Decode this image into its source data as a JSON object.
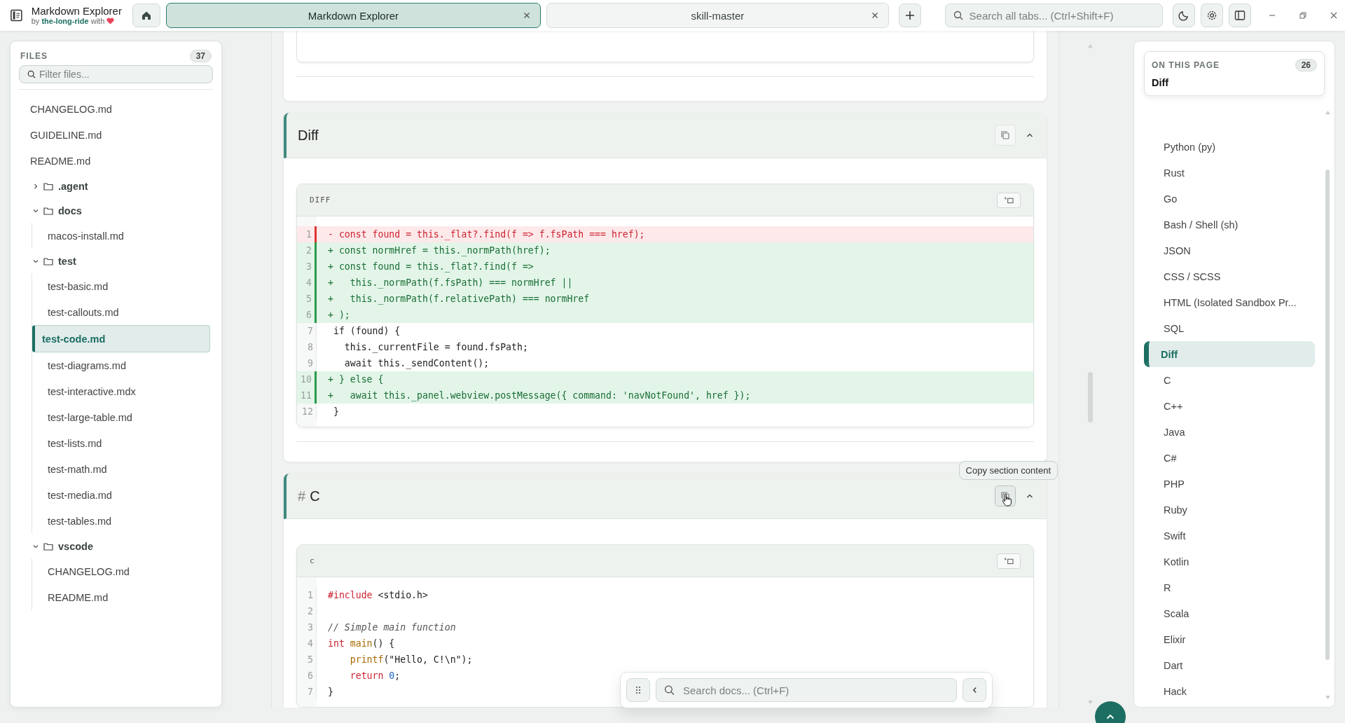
{
  "app": {
    "title": "Markdown Explorer",
    "byline": "by **the-long-ride** with"
  },
  "tabs": [
    {
      "label": "Markdown Explorer",
      "selected": true
    },
    {
      "label": "skill-master",
      "selected": false
    }
  ],
  "tab_search": {
    "placeholder": "Search all tabs... (Ctrl+Shift+F)"
  },
  "sidebar": {
    "title": "FILES",
    "count": "37",
    "filter": {
      "placeholder": "Filter files..."
    },
    "items": [
      {
        "kind": "file",
        "name": "CHANGELOG.md",
        "selected": false
      },
      {
        "kind": "file",
        "name": "GUIDELINE.md",
        "selected": false
      },
      {
        "kind": "file",
        "name": "README.md",
        "selected": false
      },
      {
        "kind": "folder",
        "name": ".agent",
        "expanded": false,
        "selected": false
      },
      {
        "kind": "folder",
        "name": "docs",
        "expanded": true,
        "selected": false,
        "children": [
          {
            "kind": "file",
            "name": "macos-install.md",
            "selected": false
          }
        ]
      },
      {
        "kind": "folder",
        "name": "test",
        "expanded": true,
        "selected": false,
        "children": [
          {
            "kind": "file",
            "name": "test-basic.md",
            "selected": false
          },
          {
            "kind": "file",
            "name": "test-callouts.md",
            "selected": false
          },
          {
            "kind": "file",
            "name": "test-code.md",
            "selected": true
          },
          {
            "kind": "file",
            "name": "test-diagrams.md",
            "selected": false
          },
          {
            "kind": "file",
            "name": "test-interactive.mdx",
            "selected": false
          },
          {
            "kind": "file",
            "name": "test-large-table.md",
            "selected": false
          },
          {
            "kind": "file",
            "name": "test-lists.md",
            "selected": false
          },
          {
            "kind": "file",
            "name": "test-math.md",
            "selected": false
          },
          {
            "kind": "file",
            "name": "test-media.md",
            "selected": false
          },
          {
            "kind": "file",
            "name": "test-tables.md",
            "selected": false
          }
        ]
      },
      {
        "kind": "folder",
        "name": "vscode",
        "expanded": true,
        "selected": false,
        "children": [
          {
            "kind": "file",
            "name": "CHANGELOG.md",
            "selected": false
          },
          {
            "kind": "file",
            "name": "README.md",
            "selected": false
          }
        ]
      }
    ]
  },
  "sections": [
    {
      "title": "Diff",
      "block": {
        "language": "DIFF",
        "kind": "diff",
        "lines": [
          {
            "number": "1",
            "removed": true,
            "added": false,
            "text": "- const found = this._flat?.find(f => f.fsPath === href);"
          },
          {
            "number": "2",
            "removed": false,
            "added": true,
            "text": "+ const normHref = this._normPath(href);"
          },
          {
            "number": "3",
            "removed": false,
            "added": true,
            "text": "+ const found = this._flat?.find(f =>"
          },
          {
            "number": "4",
            "removed": false,
            "added": true,
            "text": "+   this._normPath(f.fsPath) === normHref ||"
          },
          {
            "number": "5",
            "removed": false,
            "added": true,
            "text": "+   this._normPath(f.relativePath) === normHref"
          },
          {
            "number": "6",
            "removed": false,
            "added": true,
            "text": "+ );"
          },
          {
            "number": "7",
            "removed": false,
            "added": false,
            "text": " if (found) {"
          },
          {
            "number": "8",
            "removed": false,
            "added": false,
            "text": "   this._currentFile = found.fsPath;"
          },
          {
            "number": "9",
            "removed": false,
            "added": false,
            "text": "   await this._sendContent();"
          },
          {
            "number": "10",
            "removed": false,
            "added": true,
            "text": "+ } else {"
          },
          {
            "number": "11",
            "removed": false,
            "added": true,
            "text": "+   await this._panel.webview.postMessage({ command: 'navNotFound', href });"
          },
          {
            "number": "12",
            "removed": false,
            "added": false,
            "text": " }"
          }
        ]
      }
    },
    {
      "hash": "#",
      "title": "C",
      "tooltip": "Copy section content",
      "block": {
        "language": "c",
        "kind": "tokens",
        "lines": [
          {
            "number": "1",
            "tokens": [
              {
                "kind": "keyword",
                "text": "#include"
              },
              {
                "kind": "plain",
                "text": " <stdio.h>"
              }
            ]
          },
          {
            "number": "2"
          },
          {
            "number": "3",
            "tokens": [
              {
                "kind": "comment",
                "text": "// Simple main function"
              }
            ]
          },
          {
            "number": "4",
            "tokens": [
              {
                "kind": "keyword",
                "text": "int "
              },
              {
                "kind": "function",
                "text": "main"
              },
              {
                "kind": "plain",
                "text": "() {"
              }
            ]
          },
          {
            "number": "5",
            "tokens": [
              {
                "kind": "function",
                "text": "    printf"
              },
              {
                "kind": "plain",
                "text": "(\"Hello, C!\\n\");"
              }
            ]
          },
          {
            "number": "6",
            "tokens": [
              {
                "kind": "keyword",
                "text": "    return "
              },
              {
                "kind": "number",
                "text": "0"
              },
              {
                "kind": "plain",
                "text": ";"
              }
            ]
          },
          {
            "number": "7",
            "tokens": [
              {
                "kind": "plain",
                "text": "}"
              }
            ]
          }
        ]
      }
    }
  ],
  "doc_search": {
    "placeholder": "Search docs... (Ctrl+F)"
  },
  "toc": {
    "title": "ON THIS PAGE",
    "count": "26",
    "current": "Diff",
    "items": [
      {
        "label": "Python (py)",
        "selected": false
      },
      {
        "label": "Rust",
        "selected": false
      },
      {
        "label": "Go",
        "selected": false
      },
      {
        "label": "Bash / Shell (sh)",
        "selected": false
      },
      {
        "label": "JSON",
        "selected": false
      },
      {
        "label": "CSS / SCSS",
        "selected": false
      },
      {
        "label": "HTML (Isolated Sandbox Pr...",
        "selected": false
      },
      {
        "label": "SQL",
        "selected": false
      },
      {
        "label": "Diff",
        "selected": true
      },
      {
        "label": "C",
        "selected": false
      },
      {
        "label": "C++",
        "selected": false
      },
      {
        "label": "Java",
        "selected": false
      },
      {
        "label": "C#",
        "selected": false
      },
      {
        "label": "PHP",
        "selected": false
      },
      {
        "label": "Ruby",
        "selected": false
      },
      {
        "label": "Swift",
        "selected": false
      },
      {
        "label": "Kotlin",
        "selected": false
      },
      {
        "label": "R",
        "selected": false
      },
      {
        "label": "Scala",
        "selected": false
      },
      {
        "label": "Elixir",
        "selected": false
      },
      {
        "label": "Dart",
        "selected": false
      },
      {
        "label": "Hack",
        "selected": false
      }
    ]
  }
}
